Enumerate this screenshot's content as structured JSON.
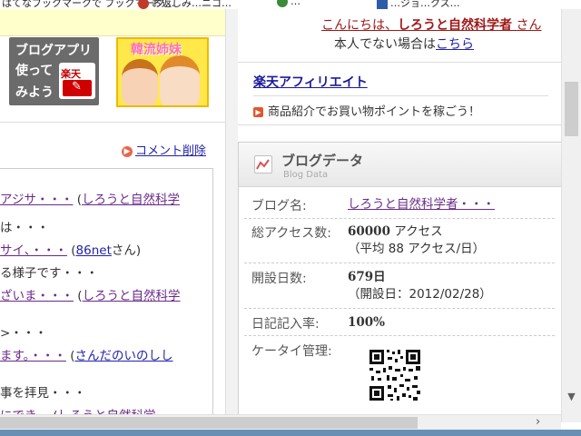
{
  "bookmarks": [
    "はてなブックマークで ブックマーク…",
    "お返しみ…ニコ…",
    "…",
    "…ジョ…クス…"
  ],
  "left": {
    "banner_app": {
      "line1": "ブログアプリ",
      "line2": "使って",
      "line3": "みよう",
      "logo_text": "楽天"
    },
    "banner_korea": {
      "text": "韓流姉妹"
    },
    "comment_delete": "コメント削除",
    "comments": [
      {
        "prefix": "アジサ",
        "link": "・・・",
        "paren_open": " (",
        "author": "しろうと自然科学"
      },
      {
        "text": "は・・・"
      },
      {
        "link": "サイ、・・・",
        "paren_open": " (",
        "author": "86net",
        "after": "さん)"
      },
      {
        "text": "る様子です・・・"
      },
      {
        "link": "ざいま・・・",
        "paren_open": " (",
        "author": "しろうと自然科学"
      },
      {
        "text": ">・・・"
      },
      {
        "link": "ます。・・・",
        "paren_open": " (",
        "author": "さんだのいのしし"
      },
      {
        "text": "事を拝見・・・"
      },
      {
        "link": "にでき…",
        "paren_open": " (",
        "author": "しろうと自然科学"
      }
    ]
  },
  "right": {
    "greeting_prefix": "こんにちは、",
    "greeting_name": "しろうと自然科学者",
    "greeting_suffix": " さん",
    "not_me_prefix": "本人でない場合は",
    "not_me_link": "こちら",
    "affiliate_title": "楽天アフィリエイト",
    "affiliate_desc": "商品紹介でお買い物ポイントを稼ごう！",
    "blog_data": {
      "title": "ブログデータ",
      "subtitle": "Blog Data",
      "blog_name_label": "ブログ名:",
      "blog_name_value": "しろうと自然科学者・・・",
      "total_access_label": "総アクセス数:",
      "total_access_value": "60000",
      "total_access_unit": " アクセス",
      "avg_access": "（平均 88 アクセス/日）",
      "open_days_label": "開設日数:",
      "open_days_value": "679日",
      "open_date": "（開設日：2012/02/28）",
      "diary_rate_label": "日記記入率:",
      "diary_rate_value": "100%",
      "mobile_label": "ケータイ管理:"
    }
  },
  "colors": {
    "link_purple": "#6a2a8a",
    "link_blue": "#2222aa",
    "greet_red": "#a01818",
    "yellow_band": "#ffffcc"
  }
}
